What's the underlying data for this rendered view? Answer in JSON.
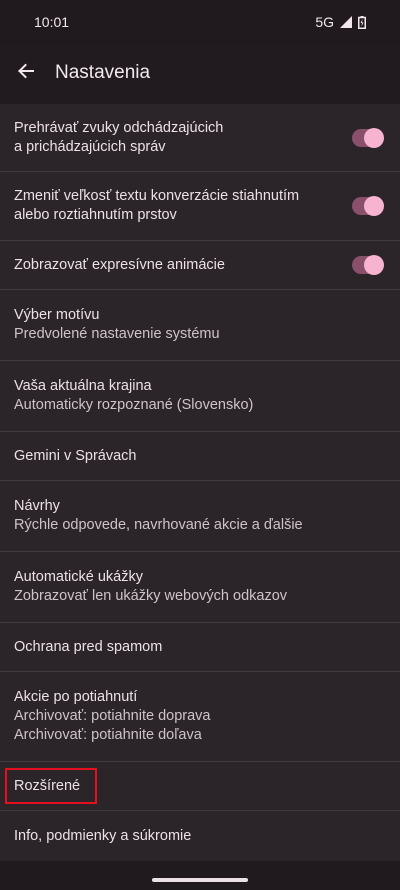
{
  "status_bar": {
    "time": "10:01",
    "network": "5G",
    "icons": [
      "signal-icon",
      "battery-icon"
    ]
  },
  "app_bar": {
    "title": "Nastavenia",
    "back_icon": "arrow-back-icon"
  },
  "settings": [
    {
      "id": "sounds",
      "title": "Prehrávať zvuky odchádzajúcich",
      "title2": "a prichádzajúcich správ",
      "toggle": true
    },
    {
      "id": "resize-text",
      "title": "Zmeniť veľkosť textu konverzácie stiahnutím",
      "title2": "alebo roztiahnutím prstov",
      "toggle": true
    },
    {
      "id": "animations",
      "title": "Zobrazovať expresívne animácie",
      "toggle": true
    },
    {
      "id": "theme",
      "title": "Výber motívu",
      "subtitle": "Predvolené nastavenie systému"
    },
    {
      "id": "country",
      "title": "Vaša aktuálna krajina",
      "subtitle": "Automaticky rozpoznané (Slovensko)"
    },
    {
      "id": "gemini",
      "title": "Gemini v Správach"
    },
    {
      "id": "suggestions",
      "title": "Návrhy",
      "subtitle": "Rýchle odpovede, navrhované akcie a ďalšie"
    },
    {
      "id": "previews",
      "title": "Automatické ukážky",
      "subtitle": "Zobrazovať len ukážky webových odkazov"
    },
    {
      "id": "spam",
      "title": "Ochrana pred spamom"
    },
    {
      "id": "swipe",
      "title": "Akcie po potiahnutí",
      "subtitle": "Archivovať: potiahnite doprava",
      "subtitle2": "Archivovať: potiahnite doľava"
    },
    {
      "id": "advanced",
      "title": "Rozšírené",
      "highlighted": true
    },
    {
      "id": "info",
      "title": "Info, podmienky a súkromie"
    }
  ],
  "colors": {
    "background": "#201a1e",
    "list_background": "#2b2428",
    "toggle_track": "#8a4f6a",
    "toggle_knob": "#f7b4d0",
    "highlight": "#e3101f"
  }
}
